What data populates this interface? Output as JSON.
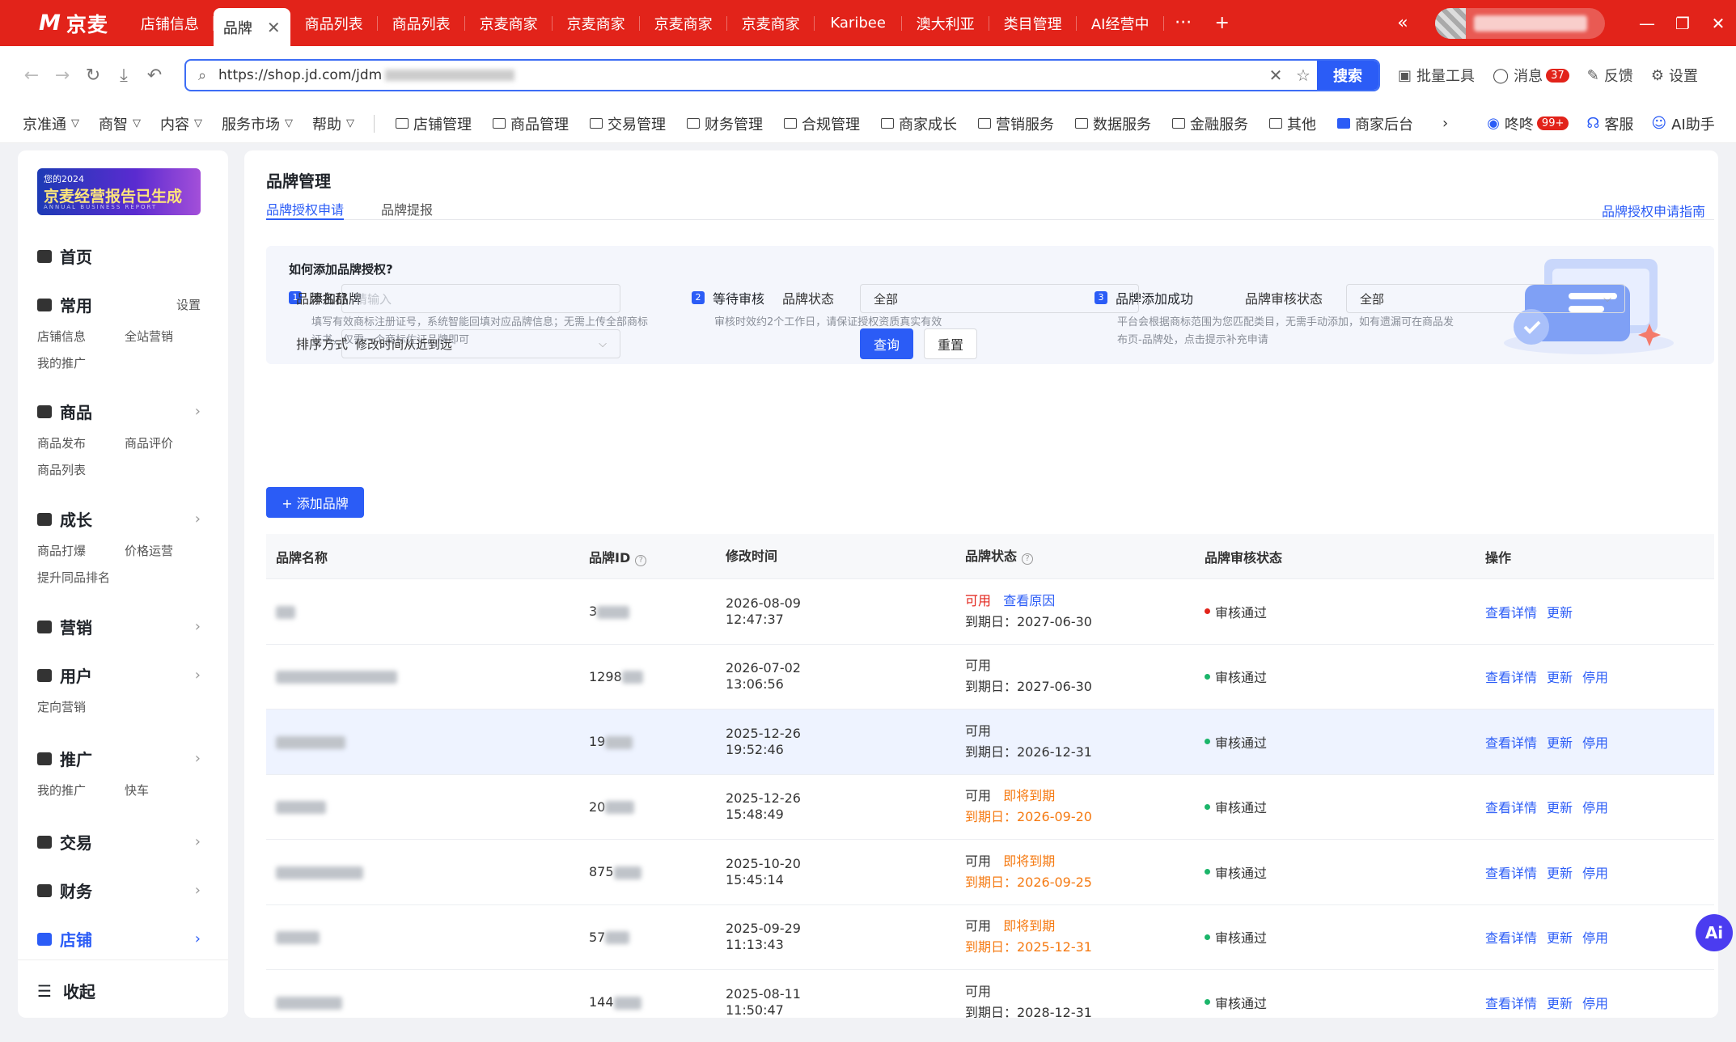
{
  "browser": {
    "app_name": "京麦",
    "tabs": [
      "店铺信息",
      "品牌",
      "商品列表",
      "商品列表",
      "京麦商家",
      "京麦商家",
      "京麦商家",
      "京麦商家",
      "Karibee",
      "澳大利亚",
      "类目管理",
      "AI经营中"
    ],
    "url": "https://shop.jd.com/jdm",
    "search_button": "搜索",
    "tools": [
      "批量工具",
      "消息",
      "反馈",
      "设置"
    ],
    "message_count": "37"
  },
  "menubar": {
    "dropdowns": [
      "京准通",
      "商智",
      "内容",
      "服务市场",
      "帮助"
    ],
    "links": [
      "店铺管理",
      "商品管理",
      "交易管理",
      "财务管理",
      "合规管理",
      "商家成长",
      "营销服务",
      "数据服务",
      "金融服务",
      "其他",
      "商家后台"
    ],
    "right": [
      "咚咚",
      "客服",
      "AI助手"
    ],
    "dongdong_badge": "99+"
  },
  "sidebar": {
    "banner_line1": "您的2024",
    "banner_line2": "京麦经营报告已生成",
    "banner_line3": "ANNUAL BUSINESS REPORT",
    "home": "首页",
    "common": "常用",
    "settings": "设置",
    "common_items": [
      "店铺信息",
      "全站营销",
      "我的推广"
    ],
    "goods": "商品",
    "goods_items": [
      "商品发布",
      "商品评价",
      "商品列表"
    ],
    "growth": "成长",
    "growth_items": [
      "商品打爆",
      "价格运营",
      "提升同品排名"
    ],
    "marketing": "营销",
    "users": "用户",
    "users_items": [
      "定向营销"
    ],
    "promo": "推广",
    "promo_items": [
      "我的推广",
      "快车"
    ],
    "trade": "交易",
    "finance": "财务",
    "shop": "店铺",
    "collapse": "收起"
  },
  "page": {
    "title": "品牌管理",
    "tab_apply": "品牌授权申请",
    "tab_report": "品牌提报",
    "guide_link": "品牌授权申请指南",
    "how_title": "如何添加品牌授权?",
    "steps": [
      {
        "title": "添加品牌",
        "desc1": "填写有效商标注册证号，系统智能回填对应品牌信息；无需上传全部商标",
        "desc2": "证书，仅需一个商标佐证品牌即可"
      },
      {
        "title": "等待审核",
        "desc1": "审核时效约2个工作日，请保证授权资质真实有效",
        "desc2": ""
      },
      {
        "title": "品牌添加成功",
        "desc1": "平台会根据商标范围为您匹配类目，无需手动添加，如有遗漏可在商品发",
        "desc2": "布页-品牌处，点击提示补充申请"
      }
    ],
    "filters": {
      "brand_name_label": "品牌名称",
      "brand_name_placeholder": "请输入",
      "brand_status_label": "品牌状态",
      "brand_status_value": "全部",
      "audit_status_label": "品牌审核状态",
      "audit_status_value": "全部",
      "sort_label": "排序方式",
      "sort_value": "修改时间从近到远",
      "query": "查询",
      "reset": "重置"
    },
    "add_brand": "+ 添加品牌",
    "table": {
      "headers": [
        "品牌名称",
        "品牌ID",
        "修改时间",
        "品牌状态",
        "品牌审核状态",
        "操作"
      ],
      "rows": [
        {
          "id": "3",
          "date": "2026-08-09",
          "time": "12:47:37",
          "status": "可用",
          "extra": "查看原因",
          "expire": "到期日：2027-06-30",
          "audit": "审核通过",
          "ops": [
            "查看详情",
            "更新"
          ]
        },
        {
          "id": "1298",
          "date": "2026-07-02",
          "time": "13:06:56",
          "status": "可用",
          "extra": "",
          "expire": "到期日：2027-06-30",
          "audit": "审核通过",
          "ops": [
            "查看详情",
            "更新",
            "停用"
          ]
        },
        {
          "id": "19",
          "date": "2025-12-26",
          "time": "19:52:46",
          "status": "可用",
          "extra": "",
          "expire": "到期日：2026-12-31",
          "audit": "审核通过",
          "ops": [
            "查看详情",
            "更新",
            "停用"
          ]
        },
        {
          "id": "20",
          "date": "2025-12-26",
          "time": "15:48:49",
          "status": "可用",
          "extra": "即将到期",
          "expire": "到期日：2026-09-20",
          "audit": "审核通过",
          "ops": [
            "查看详情",
            "更新",
            "停用"
          ]
        },
        {
          "id": "875",
          "date": "2025-10-20",
          "time": "15:45:14",
          "status": "可用",
          "extra": "即将到期",
          "expire": "到期日：2026-09-25",
          "audit": "审核通过",
          "ops": [
            "查看详情",
            "更新",
            "停用"
          ]
        },
        {
          "id": "57",
          "date": "2025-09-29",
          "time": "11:13:43",
          "status": "可用",
          "extra": "即将到期",
          "expire": "到期日：2025-12-31",
          "audit": "审核通过",
          "ops": [
            "查看详情",
            "更新",
            "停用"
          ]
        },
        {
          "id": "144",
          "date": "2025-08-11",
          "time": "11:50:47",
          "status": "可用",
          "extra": "",
          "expire": "到期日：2028-12-31",
          "audit": "审核通过",
          "ops": [
            "查看详情",
            "更新",
            "停用"
          ]
        }
      ]
    }
  },
  "fab_label": "Ai"
}
